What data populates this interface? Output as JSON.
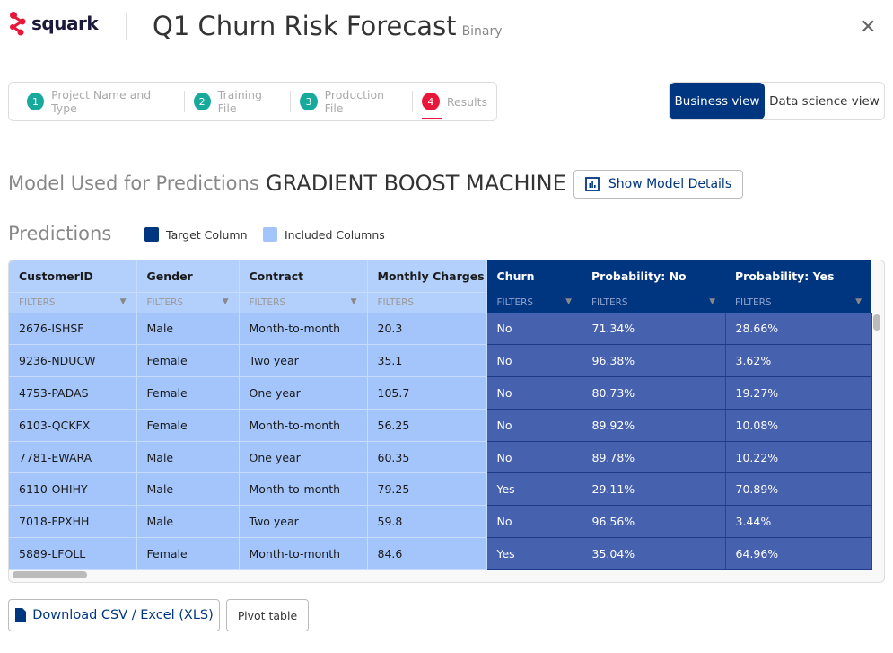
{
  "app": {
    "logo": "squark",
    "title": "Q1 Churn Risk Forecast",
    "subtitle": "Binary",
    "close_icon": "close-icon"
  },
  "steps": [
    {
      "num": "1",
      "label": "Project Name and Type"
    },
    {
      "num": "2",
      "label": "Training File"
    },
    {
      "num": "3",
      "label": "Production File"
    },
    {
      "num": "4",
      "label": "Results",
      "active": true
    }
  ],
  "view_toggle": {
    "business": "Business view",
    "data_science": "Data science view",
    "selected": "Business view"
  },
  "model": {
    "label": "Model Used for Predictions",
    "name": "GRADIENT BOOST MACHINE",
    "details_button": "Show Model Details"
  },
  "predictions": {
    "title": "Predictions",
    "legend": [
      {
        "label": "Target Column",
        "color": "#003580"
      },
      {
        "label": "Included Columns",
        "color": "#a3c5fb"
      }
    ]
  },
  "table": {
    "filter_placeholder": "FILTERS",
    "columns": [
      {
        "name": "CustomerID",
        "type": "inc",
        "dropdown": true
      },
      {
        "name": "Gender",
        "type": "inc",
        "dropdown": true
      },
      {
        "name": "Contract",
        "type": "inc",
        "dropdown": true
      },
      {
        "name": "Monthly Charges",
        "type": "inc",
        "dropdown": false
      },
      {
        "name": "Churn",
        "type": "tgt",
        "dropdown": true
      },
      {
        "name": "Probability: No",
        "type": "tgt",
        "dropdown": true
      },
      {
        "name": "Probability: Yes",
        "type": "tgt",
        "dropdown": true
      }
    ],
    "rows": [
      [
        "2676-ISHSF",
        "Male",
        "Month-to-month",
        "20.3",
        "No",
        "71.34%",
        "28.66%"
      ],
      [
        "9236-NDUCW",
        "Female",
        "Two year",
        "35.1",
        "No",
        "96.38%",
        "3.62%"
      ],
      [
        "4753-PADAS",
        "Female",
        "One year",
        "105.7",
        "No",
        "80.73%",
        "19.27%"
      ],
      [
        "6103-QCKFX",
        "Female",
        "Month-to-month",
        "56.25",
        "No",
        "89.92%",
        "10.08%"
      ],
      [
        "7781-EWARA",
        "Male",
        "One year",
        "60.35",
        "No",
        "89.78%",
        "10.22%"
      ],
      [
        "6110-OHIHY",
        "Male",
        "Month-to-month",
        "79.25",
        "Yes",
        "29.11%",
        "70.89%"
      ],
      [
        "7018-FPXHH",
        "Male",
        "Two year",
        "59.8",
        "No",
        "96.56%",
        "3.44%"
      ],
      [
        "5889-LFOLL",
        "Female",
        "Month-to-month",
        "84.6",
        "Yes",
        "35.04%",
        "64.96%"
      ]
    ]
  },
  "actions": {
    "download": "Download CSV / Excel (XLS)",
    "pivot": "Pivot table"
  }
}
